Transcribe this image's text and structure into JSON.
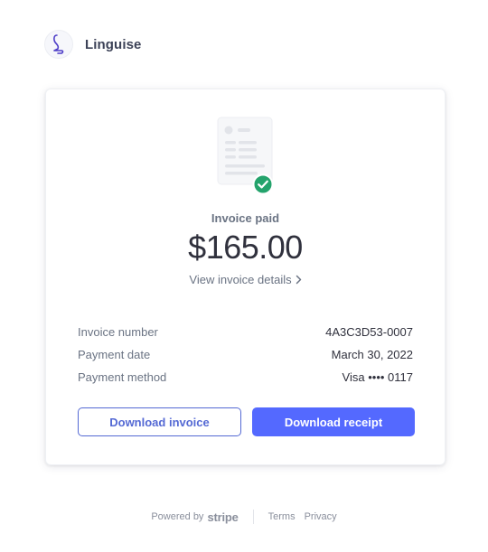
{
  "brand": {
    "name": "Linguise"
  },
  "invoice": {
    "status_label": "Invoice paid",
    "amount": "$165.00",
    "details_link": "View invoice details"
  },
  "info_rows": [
    {
      "label": "Invoice number",
      "value": "4A3C3D53-0007"
    },
    {
      "label": "Payment date",
      "value": "March 30, 2022"
    },
    {
      "label": "Payment method",
      "value": "Visa •••• 0117"
    }
  ],
  "actions": {
    "download_invoice": "Download invoice",
    "download_receipt": "Download receipt"
  },
  "footer": {
    "powered_by": "Powered by",
    "stripe": "stripe",
    "terms": "Terms",
    "privacy": "Privacy"
  },
  "colors": {
    "accent": "#5469ff",
    "success": "#24a36c",
    "text": "#30313d",
    "muted": "#6a7383"
  },
  "icons": {
    "brand": "linguise-logo-icon",
    "document": "invoice-document-icon",
    "check": "check-circle-icon",
    "chevron": "chevron-right-icon"
  }
}
